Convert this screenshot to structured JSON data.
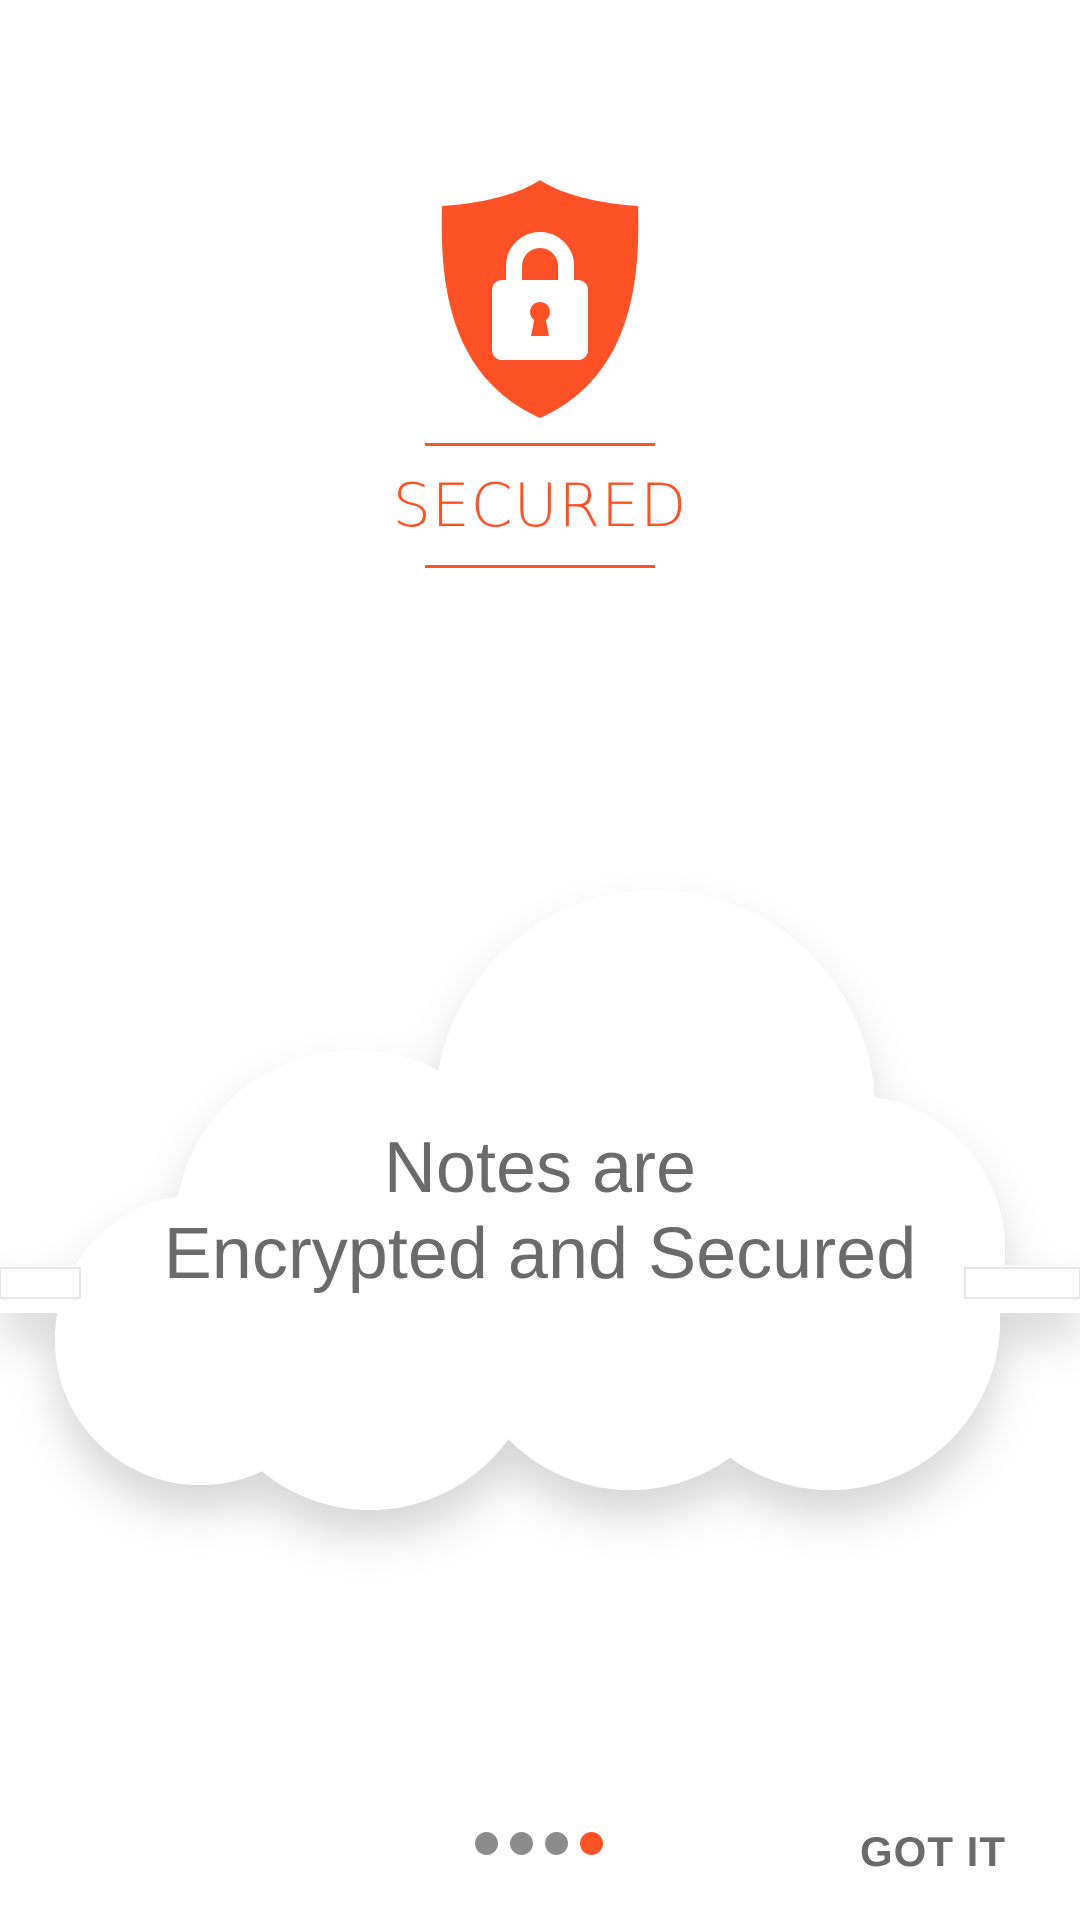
{
  "brand": {
    "title": "SECURED",
    "icon": "shield-lock-icon",
    "accent_color": "#ff5126"
  },
  "slide": {
    "line1": "Notes are",
    "line2": "Encrypted and Secured",
    "illustration": "cloud-icon"
  },
  "pager": {
    "total": 4,
    "current": 4,
    "inactive_color": "#8c8c8c",
    "active_color": "#ff5126"
  },
  "actions": {
    "done_label": "GOT IT"
  }
}
